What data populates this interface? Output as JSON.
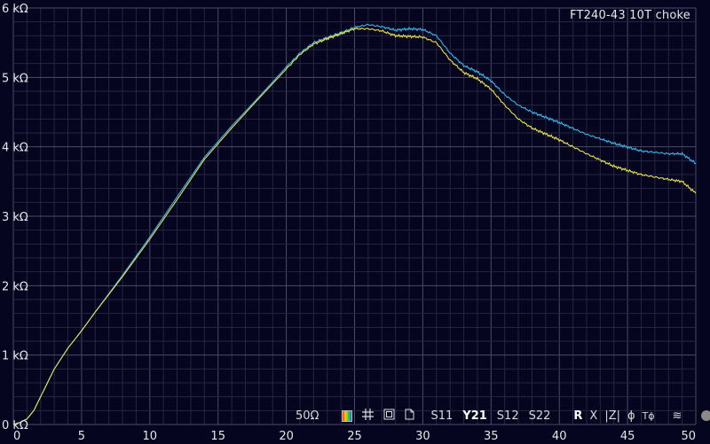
{
  "title": "FT240-43 10T choke",
  "toolbar": {
    "impedance": "50Ω",
    "params": [
      "S11",
      "Y21",
      "S12",
      "S22"
    ],
    "active_param": "Y21",
    "part_labels": [
      "R",
      "X",
      "|Z|",
      "ϕ",
      "Tϕ"
    ],
    "active_part": "R",
    "icons": [
      "color-palette-icon",
      "grid-icon",
      "window-icon",
      "document-icon",
      "smoothing-icon",
      "record-dot-icon"
    ]
  },
  "colors": {
    "background": "#050520",
    "grid": "#3a3a58",
    "series_cyan": "#3ab4e6",
    "series_yellow": "#e6e050",
    "text": "#e6e6e6"
  },
  "chart_data": {
    "type": "line",
    "title": "FT240-43 10T choke",
    "xlabel": "",
    "ylabel": "",
    "xlim": [
      0,
      50
    ],
    "ylim": [
      0,
      6
    ],
    "grid": true,
    "x_ticks": [
      "0",
      "5",
      "10",
      "15",
      "20",
      "25",
      "30",
      "35",
      "40",
      "45",
      "50"
    ],
    "y_ticks": [
      "0 kΩ",
      "1 kΩ",
      "2 kΩ",
      "3 kΩ",
      "4 kΩ",
      "5 kΩ",
      "6 kΩ"
    ],
    "y_tick_values": [
      0,
      1,
      2,
      3,
      4,
      5,
      6
    ],
    "x_tick_values": [
      0,
      5,
      10,
      15,
      20,
      25,
      30,
      35,
      40,
      45,
      50
    ],
    "series": [
      {
        "color": "#3ab4e6",
        "x": [
          0,
          0.5,
          1,
          1.5,
          2,
          3,
          4,
          5,
          6,
          8,
          10,
          12,
          14,
          16,
          18,
          20,
          21,
          22,
          23,
          24,
          25,
          26,
          27,
          28,
          29,
          30,
          31,
          32,
          33,
          34,
          35,
          36,
          37,
          38,
          40,
          42,
          44,
          46,
          48,
          49,
          50
        ],
        "values": [
          0.0,
          0.03,
          0.08,
          0.2,
          0.4,
          0.8,
          1.1,
          1.35,
          1.62,
          2.15,
          2.7,
          3.28,
          3.85,
          4.3,
          4.72,
          5.15,
          5.35,
          5.5,
          5.57,
          5.64,
          5.72,
          5.76,
          5.73,
          5.68,
          5.7,
          5.69,
          5.6,
          5.35,
          5.17,
          5.08,
          4.95,
          4.75,
          4.6,
          4.5,
          4.35,
          4.18,
          4.05,
          3.94,
          3.9,
          3.9,
          3.76
        ]
      },
      {
        "color": "#e6e050",
        "x": [
          0,
          0.5,
          1,
          1.5,
          2,
          3,
          4,
          5,
          6,
          8,
          10,
          12,
          14,
          16,
          18,
          20,
          21,
          22,
          23,
          24,
          25,
          26,
          27,
          28,
          29,
          30,
          31,
          32,
          33,
          34,
          35,
          36,
          37,
          38,
          40,
          42,
          44,
          46,
          48,
          49,
          50
        ],
        "values": [
          0.0,
          0.03,
          0.08,
          0.2,
          0.4,
          0.8,
          1.1,
          1.35,
          1.62,
          2.13,
          2.67,
          3.24,
          3.82,
          4.27,
          4.7,
          5.12,
          5.33,
          5.48,
          5.56,
          5.63,
          5.7,
          5.7,
          5.67,
          5.6,
          5.59,
          5.58,
          5.5,
          5.25,
          5.07,
          4.98,
          4.83,
          4.6,
          4.4,
          4.27,
          4.1,
          3.9,
          3.72,
          3.6,
          3.53,
          3.5,
          3.33
        ]
      }
    ]
  }
}
